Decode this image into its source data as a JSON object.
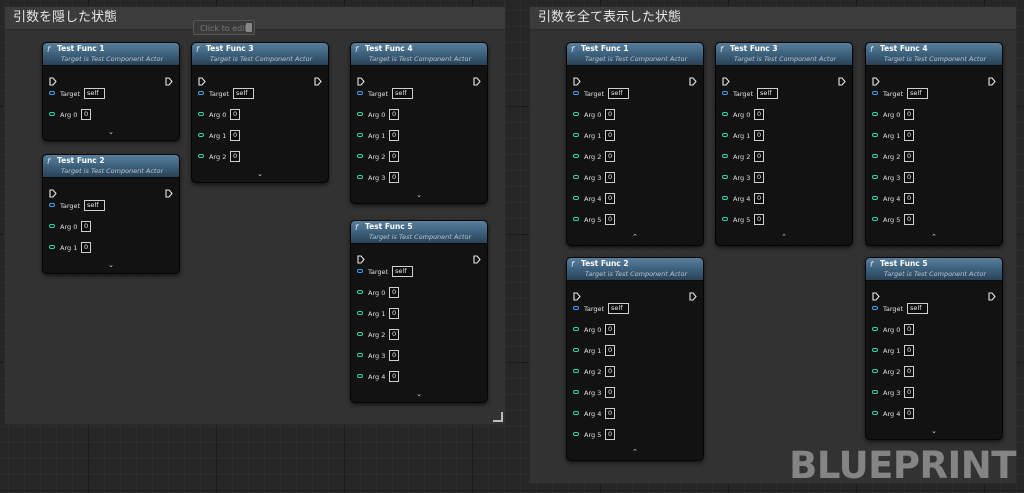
{
  "comments": [
    {
      "title": "引数を隠した状態"
    },
    {
      "title": "引数を全て表示した状態"
    }
  ],
  "click_to_edit": "Click to edit",
  "watermark": "BLUEPRINT",
  "node_subtitle": "Target is Test Component Actor",
  "fn_icon": "f",
  "nodes": [
    {
      "title": "Test Func 1",
      "target": "self",
      "args": [
        {
          "label": "Arg 0",
          "value": "0"
        }
      ],
      "expander": "⌄"
    },
    {
      "title": "Test Func 2",
      "target": "self",
      "args": [
        {
          "label": "Arg 0",
          "value": "0"
        },
        {
          "label": "Arg 1",
          "value": "0"
        }
      ],
      "expander": "⌄"
    },
    {
      "title": "Test Func 3",
      "target": "self",
      "args": [
        {
          "label": "Arg 0",
          "value": "0"
        },
        {
          "label": "Arg 1",
          "value": "0"
        },
        {
          "label": "Arg 2",
          "value": "0"
        }
      ],
      "expander": "⌄"
    },
    {
      "title": "Test Func 4",
      "target": "self",
      "args": [
        {
          "label": "Arg 0",
          "value": "0"
        },
        {
          "label": "Arg 1",
          "value": "0"
        },
        {
          "label": "Arg 2",
          "value": "0"
        },
        {
          "label": "Arg 3",
          "value": "0"
        }
      ],
      "expander": "⌄"
    },
    {
      "title": "Test Func 5",
      "target": "self",
      "args": [
        {
          "label": "Arg 0",
          "value": "0"
        },
        {
          "label": "Arg 1",
          "value": "0"
        },
        {
          "label": "Arg 2",
          "value": "0"
        },
        {
          "label": "Arg 3",
          "value": "0"
        },
        {
          "label": "Arg 4",
          "value": "0"
        }
      ],
      "expander": "⌄"
    },
    {
      "title": "Test Func 1",
      "target": "self",
      "args": [
        {
          "label": "Arg 0",
          "value": "0"
        },
        {
          "label": "Arg 1",
          "value": "0"
        },
        {
          "label": "Arg 2",
          "value": "0"
        },
        {
          "label": "Arg 3",
          "value": "0"
        },
        {
          "label": "Arg 4",
          "value": "0"
        },
        {
          "label": "Arg 5",
          "value": "0"
        }
      ],
      "expander": "⌃"
    },
    {
      "title": "Test Func 2",
      "target": "self",
      "args": [
        {
          "label": "Arg 0",
          "value": "0"
        },
        {
          "label": "Arg 1",
          "value": "0"
        },
        {
          "label": "Arg 2",
          "value": "0"
        },
        {
          "label": "Arg 3",
          "value": "0"
        },
        {
          "label": "Arg 4",
          "value": "0"
        },
        {
          "label": "Arg 5",
          "value": "0"
        }
      ],
      "expander": "⌃"
    },
    {
      "title": "Test Func 3",
      "target": "self",
      "args": [
        {
          "label": "Arg 0",
          "value": "0"
        },
        {
          "label": "Arg 1",
          "value": "0"
        },
        {
          "label": "Arg 2",
          "value": "0"
        },
        {
          "label": "Arg 3",
          "value": "0"
        },
        {
          "label": "Arg 4",
          "value": "0"
        },
        {
          "label": "Arg 5",
          "value": "0"
        }
      ],
      "expander": "⌃"
    },
    {
      "title": "Test Func 4",
      "target": "self",
      "args": [
        {
          "label": "Arg 0",
          "value": "0"
        },
        {
          "label": "Arg 1",
          "value": "0"
        },
        {
          "label": "Arg 2",
          "value": "0"
        },
        {
          "label": "Arg 3",
          "value": "0"
        },
        {
          "label": "Arg 4",
          "value": "0"
        },
        {
          "label": "Arg 5",
          "value": "0"
        }
      ],
      "expander": "⌃"
    },
    {
      "title": "Test Func 5",
      "target": "self",
      "args": [
        {
          "label": "Arg 0",
          "value": "0"
        },
        {
          "label": "Arg 1",
          "value": "0"
        },
        {
          "label": "Arg 2",
          "value": "0"
        },
        {
          "label": "Arg 3",
          "value": "0"
        },
        {
          "label": "Arg 4",
          "value": "0"
        }
      ],
      "expander": "⌄"
    }
  ]
}
